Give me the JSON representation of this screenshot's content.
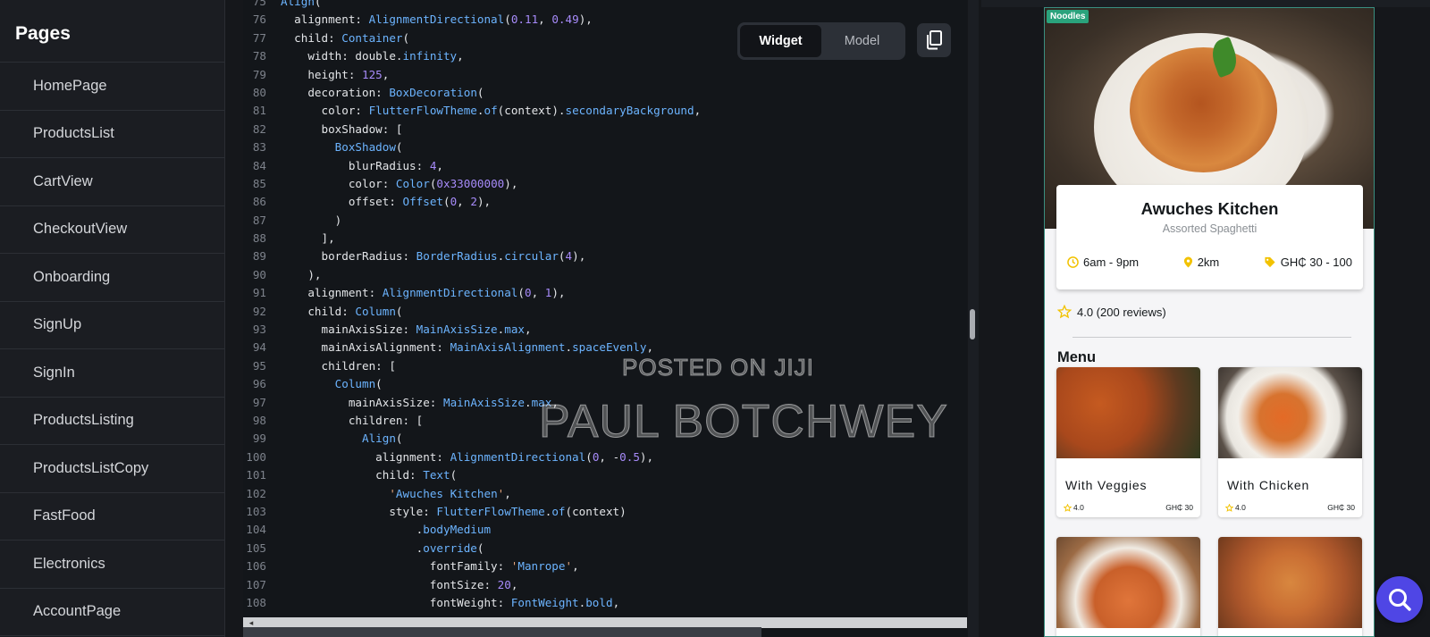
{
  "sidebar": {
    "title": "Pages",
    "items": [
      {
        "label": "HomePage"
      },
      {
        "label": "ProductsList"
      },
      {
        "label": "CartView"
      },
      {
        "label": "CheckoutView"
      },
      {
        "label": "Onboarding"
      },
      {
        "label": "SignUp"
      },
      {
        "label": "SignIn"
      },
      {
        "label": "ProductsListing"
      },
      {
        "label": "ProductsListCopy"
      },
      {
        "label": "FastFood"
      },
      {
        "label": "Electronics"
      },
      {
        "label": "AccountPage"
      }
    ]
  },
  "code": {
    "toggle": {
      "widget": "Widget",
      "model": "Model",
      "active": "Widget"
    },
    "copy_icon": "copy-icon",
    "lines": [
      {
        "n": "75",
        "t": "Align("
      },
      {
        "n": "76",
        "t": "  alignment: AlignmentDirectional(0.11, 0.49),"
      },
      {
        "n": "77",
        "t": "  child: Container("
      },
      {
        "n": "78",
        "t": "    width: double.infinity,"
      },
      {
        "n": "79",
        "t": "    height: 125,"
      },
      {
        "n": "80",
        "t": "    decoration: BoxDecoration("
      },
      {
        "n": "81",
        "t": "      color: FlutterFlowTheme.of(context).secondaryBackground,"
      },
      {
        "n": "82",
        "t": "      boxShadow: ["
      },
      {
        "n": "83",
        "t": "        BoxShadow("
      },
      {
        "n": "84",
        "t": "          blurRadius: 4,"
      },
      {
        "n": "85",
        "t": "          color: Color(0x33000000),"
      },
      {
        "n": "86",
        "t": "          offset: Offset(0, 2),"
      },
      {
        "n": "87",
        "t": "        )"
      },
      {
        "n": "88",
        "t": "      ],"
      },
      {
        "n": "89",
        "t": "      borderRadius: BorderRadius.circular(4),"
      },
      {
        "n": "90",
        "t": "    ),"
      },
      {
        "n": "91",
        "t": "    alignment: AlignmentDirectional(0, 1),"
      },
      {
        "n": "92",
        "t": "    child: Column("
      },
      {
        "n": "93",
        "t": "      mainAxisSize: MainAxisSize.max,"
      },
      {
        "n": "94",
        "t": "      mainAxisAlignment: MainAxisAlignment.spaceEvenly,"
      },
      {
        "n": "95",
        "t": "      children: ["
      },
      {
        "n": "96",
        "t": "        Column("
      },
      {
        "n": "97",
        "t": "          mainAxisSize: MainAxisSize.max,"
      },
      {
        "n": "98",
        "t": "          children: ["
      },
      {
        "n": "99",
        "t": "            Align("
      },
      {
        "n": "100",
        "t": "              alignment: AlignmentDirectional(0, -0.5),"
      },
      {
        "n": "101",
        "t": "              child: Text("
      },
      {
        "n": "102",
        "t": "                'Awuches Kitchen',"
      },
      {
        "n": "103",
        "t": "                style: FlutterFlowTheme.of(context)"
      },
      {
        "n": "104",
        "t": "                    .bodyMedium"
      },
      {
        "n": "105",
        "t": "                    .override("
      },
      {
        "n": "106",
        "t": "                      fontFamily: 'Manrope',"
      },
      {
        "n": "107",
        "t": "                      fontSize: 20,"
      },
      {
        "n": "108",
        "t": "                      fontWeight: FontWeight.bold,"
      }
    ]
  },
  "watermark": {
    "line1": "POSTED ON JIJI",
    "line2": "PAUL BOTCHWEY"
  },
  "preview": {
    "tag": "Noodles",
    "title": "Awuches Kitchen",
    "subtitle": "Assorted Spaghetti",
    "hours": "6am - 9pm",
    "distance": "2km",
    "price_range": "GH₵ 30 - 100",
    "rating": "4.0 (200 reviews)",
    "menu_title": "Menu",
    "items": [
      {
        "name": "With Veggies",
        "rating": "4.0",
        "price": "GH₵ 30"
      },
      {
        "name": "With Chicken",
        "rating": "4.0",
        "price": "GH₵ 30"
      }
    ],
    "accent": "#f2c200",
    "tag_color": "#2aa37c"
  },
  "fab": {
    "icon": "search-icon",
    "color": "#4f46e5"
  }
}
